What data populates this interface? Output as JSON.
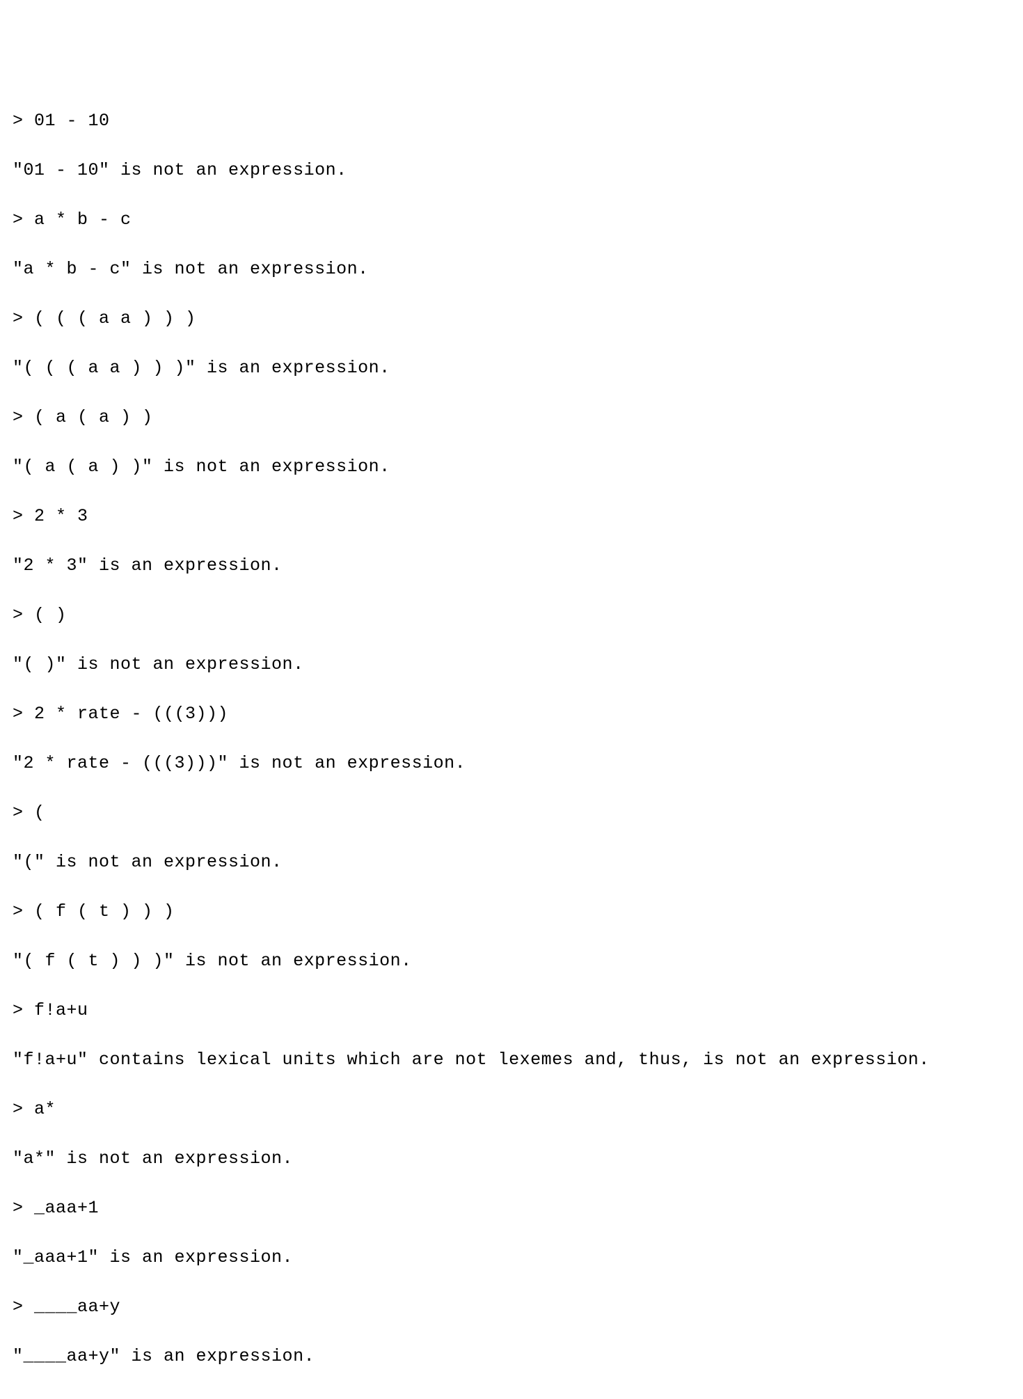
{
  "lines": [
    "> 01 - 10",
    "\"01 - 10\" is not an expression.",
    "> a * b - c",
    "\"a * b - c\" is not an expression.",
    "> ( ( ( a a ) ) )",
    "\"( ( ( a a ) ) )\" is an expression.",
    "> ( a ( a ) )",
    "\"( a ( a ) )\" is not an expression.",
    "> 2 * 3",
    "\"2 * 3\" is an expression.",
    "> ( )",
    "\"( )\" is not an expression.",
    "> 2 * rate - (((3)))",
    "\"2 * rate - (((3)))\" is not an expression.",
    "> (",
    "\"(\" is not an expression.",
    "> ( f ( t ) ) )",
    "\"( f ( t ) ) )\" is not an expression.",
    "> f!a+u",
    "\"f!a+u\" contains lexical units which are not lexemes and, thus, is not an expression.",
    "> a*",
    "\"a*\" is not an expression.",
    "> _aaa+1",
    "\"_aaa+1\" is an expression.",
    "> ____aa+y",
    "\"____aa+y\" is an expression."
  ]
}
